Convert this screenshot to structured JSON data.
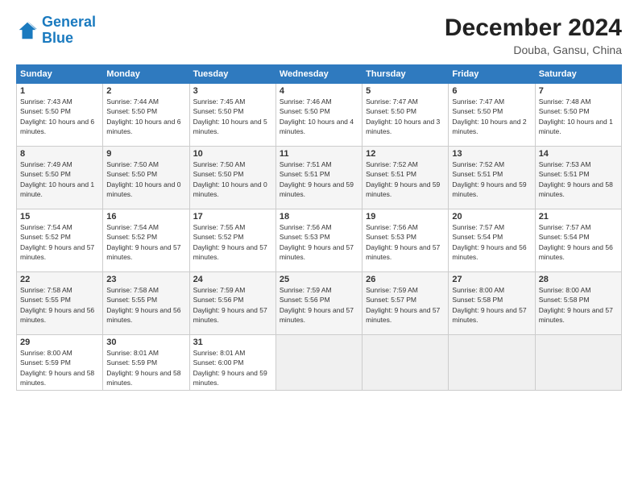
{
  "logo": {
    "line1": "General",
    "line2": "Blue"
  },
  "title": "December 2024",
  "location": "Douba, Gansu, China",
  "days_header": [
    "Sunday",
    "Monday",
    "Tuesday",
    "Wednesday",
    "Thursday",
    "Friday",
    "Saturday"
  ],
  "weeks": [
    [
      {
        "day": "1",
        "sunrise": "7:43 AM",
        "sunset": "5:50 PM",
        "daylight": "10 hours and 6 minutes."
      },
      {
        "day": "2",
        "sunrise": "7:44 AM",
        "sunset": "5:50 PM",
        "daylight": "10 hours and 6 minutes."
      },
      {
        "day": "3",
        "sunrise": "7:45 AM",
        "sunset": "5:50 PM",
        "daylight": "10 hours and 5 minutes."
      },
      {
        "day": "4",
        "sunrise": "7:46 AM",
        "sunset": "5:50 PM",
        "daylight": "10 hours and 4 minutes."
      },
      {
        "day": "5",
        "sunrise": "7:47 AM",
        "sunset": "5:50 PM",
        "daylight": "10 hours and 3 minutes."
      },
      {
        "day": "6",
        "sunrise": "7:47 AM",
        "sunset": "5:50 PM",
        "daylight": "10 hours and 2 minutes."
      },
      {
        "day": "7",
        "sunrise": "7:48 AM",
        "sunset": "5:50 PM",
        "daylight": "10 hours and 1 minute."
      }
    ],
    [
      {
        "day": "8",
        "sunrise": "7:49 AM",
        "sunset": "5:50 PM",
        "daylight": "10 hours and 1 minute."
      },
      {
        "day": "9",
        "sunrise": "7:50 AM",
        "sunset": "5:50 PM",
        "daylight": "10 hours and 0 minutes."
      },
      {
        "day": "10",
        "sunrise": "7:50 AM",
        "sunset": "5:50 PM",
        "daylight": "10 hours and 0 minutes."
      },
      {
        "day": "11",
        "sunrise": "7:51 AM",
        "sunset": "5:51 PM",
        "daylight": "9 hours and 59 minutes."
      },
      {
        "day": "12",
        "sunrise": "7:52 AM",
        "sunset": "5:51 PM",
        "daylight": "9 hours and 59 minutes."
      },
      {
        "day": "13",
        "sunrise": "7:52 AM",
        "sunset": "5:51 PM",
        "daylight": "9 hours and 59 minutes."
      },
      {
        "day": "14",
        "sunrise": "7:53 AM",
        "sunset": "5:51 PM",
        "daylight": "9 hours and 58 minutes."
      }
    ],
    [
      {
        "day": "15",
        "sunrise": "7:54 AM",
        "sunset": "5:52 PM",
        "daylight": "9 hours and 57 minutes."
      },
      {
        "day": "16",
        "sunrise": "7:54 AM",
        "sunset": "5:52 PM",
        "daylight": "9 hours and 57 minutes."
      },
      {
        "day": "17",
        "sunrise": "7:55 AM",
        "sunset": "5:52 PM",
        "daylight": "9 hours and 57 minutes."
      },
      {
        "day": "18",
        "sunrise": "7:56 AM",
        "sunset": "5:53 PM",
        "daylight": "9 hours and 57 minutes."
      },
      {
        "day": "19",
        "sunrise": "7:56 AM",
        "sunset": "5:53 PM",
        "daylight": "9 hours and 57 minutes."
      },
      {
        "day": "20",
        "sunrise": "7:57 AM",
        "sunset": "5:54 PM",
        "daylight": "9 hours and 56 minutes."
      },
      {
        "day": "21",
        "sunrise": "7:57 AM",
        "sunset": "5:54 PM",
        "daylight": "9 hours and 56 minutes."
      }
    ],
    [
      {
        "day": "22",
        "sunrise": "7:58 AM",
        "sunset": "5:55 PM",
        "daylight": "9 hours and 56 minutes."
      },
      {
        "day": "23",
        "sunrise": "7:58 AM",
        "sunset": "5:55 PM",
        "daylight": "9 hours and 56 minutes."
      },
      {
        "day": "24",
        "sunrise": "7:59 AM",
        "sunset": "5:56 PM",
        "daylight": "9 hours and 57 minutes."
      },
      {
        "day": "25",
        "sunrise": "7:59 AM",
        "sunset": "5:56 PM",
        "daylight": "9 hours and 57 minutes."
      },
      {
        "day": "26",
        "sunrise": "7:59 AM",
        "sunset": "5:57 PM",
        "daylight": "9 hours and 57 minutes."
      },
      {
        "day": "27",
        "sunrise": "8:00 AM",
        "sunset": "5:58 PM",
        "daylight": "9 hours and 57 minutes."
      },
      {
        "day": "28",
        "sunrise": "8:00 AM",
        "sunset": "5:58 PM",
        "daylight": "9 hours and 57 minutes."
      }
    ],
    [
      {
        "day": "29",
        "sunrise": "8:00 AM",
        "sunset": "5:59 PM",
        "daylight": "9 hours and 58 minutes."
      },
      {
        "day": "30",
        "sunrise": "8:01 AM",
        "sunset": "5:59 PM",
        "daylight": "9 hours and 58 minutes."
      },
      {
        "day": "31",
        "sunrise": "8:01 AM",
        "sunset": "6:00 PM",
        "daylight": "9 hours and 59 minutes."
      },
      null,
      null,
      null,
      null
    ]
  ]
}
